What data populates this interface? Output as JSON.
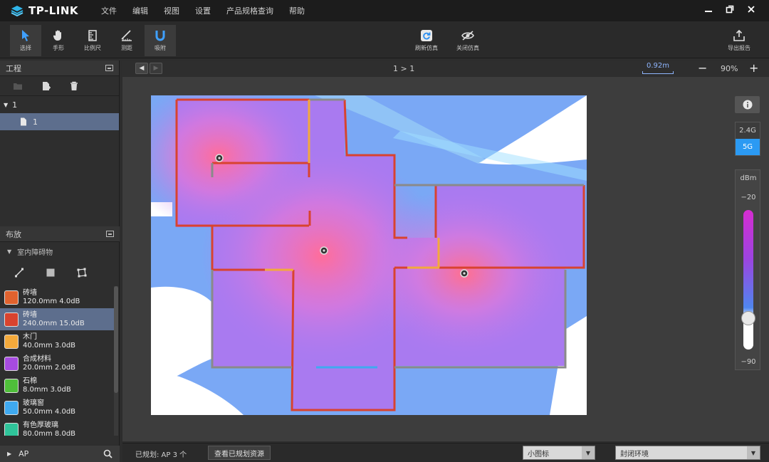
{
  "app": {
    "logo_text": "TP-LINK",
    "menu": [
      "文件",
      "编辑",
      "视图",
      "设置",
      "产品规格查询",
      "帮助"
    ],
    "window_buttons": [
      "minimize-icon",
      "restore-icon",
      "close-icon"
    ]
  },
  "toolbar": {
    "tools": [
      {
        "label": "选择",
        "icon": "cursor-icon",
        "active": true
      },
      {
        "label": "手形",
        "icon": "hand-icon",
        "active": false
      },
      {
        "label": "比例尺",
        "icon": "ruler-icon",
        "active": false
      },
      {
        "label": "测距",
        "icon": "measure-icon",
        "active": false
      },
      {
        "label": "吸附",
        "icon": "magnet-icon",
        "active": true
      }
    ],
    "refresh_label": "刷新仿真",
    "close_sim_label": "关闭仿真",
    "export_label": "导出报告"
  },
  "project_panel": {
    "title": "工程",
    "tree": [
      {
        "label": "1",
        "level": 0,
        "expanded": true,
        "selected": false
      },
      {
        "label": "1",
        "level": 1,
        "selected": true
      }
    ]
  },
  "layout_panel": {
    "title": "布放",
    "category": "室内障碍物",
    "materials": [
      {
        "name": "砖墙",
        "spec": "120.0mm 4.0dB",
        "color": "#e0622e",
        "selected": false
      },
      {
        "name": "砖墙",
        "spec": "240.0mm 15.0dB",
        "color": "#d8432f",
        "selected": true
      },
      {
        "name": "木门",
        "spec": "40.0mm 3.0dB",
        "color": "#f3a93b",
        "selected": false
      },
      {
        "name": "合成材料",
        "spec": "20.0mm 2.0dB",
        "color": "#a64be0",
        "selected": false
      },
      {
        "name": "石棉",
        "spec": "8.0mm 3.0dB",
        "color": "#4fbf3a",
        "selected": false
      },
      {
        "name": "玻璃窗",
        "spec": "50.0mm 4.0dB",
        "color": "#3fa9f0",
        "selected": false
      },
      {
        "name": "有色厚玻璃",
        "spec": "80.0mm 8.0dB",
        "color": "#2fc49a",
        "selected": false
      }
    ],
    "footer_label": "AP"
  },
  "canvas": {
    "breadcrumb": "1 > 1",
    "scale_label": "0.92m",
    "zoom": "90%"
  },
  "legend": {
    "bands": [
      "2.4G",
      "5G"
    ],
    "active_band": "5G",
    "unit": "dBm",
    "max": "−20",
    "min": "−90"
  },
  "status": {
    "planned_text": "已规划: AP 3 个",
    "view_resources_label": "查看已规划资源",
    "icon_size_select": "小图标",
    "environment_select": "封闭环境"
  }
}
